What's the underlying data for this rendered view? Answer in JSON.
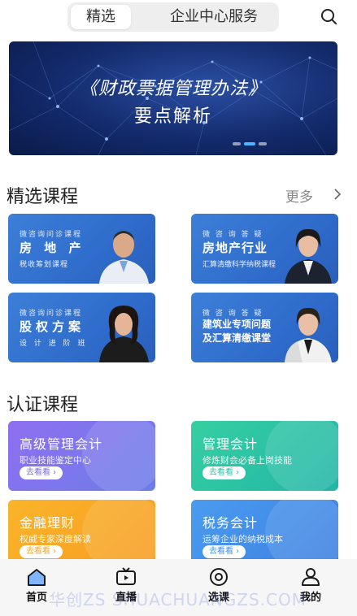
{
  "top_tabs": [
    "精选",
    "企业中心服务"
  ],
  "banner": {
    "line1": "《财政票据管理办法》",
    "line2": "要点解析"
  },
  "featured": {
    "title": "精选课程",
    "more": "更多",
    "courses": [
      {
        "tag": "微咨询问诊课程",
        "title": "房 地 产",
        "sub": "税收筹划课程"
      },
      {
        "tag": "微 咨 询 答 疑",
        "title": "房地产行业",
        "sub": "汇算清缴科学纳税课程"
      },
      {
        "tag": "微咨询问诊课程",
        "title": "股权方案",
        "sub": "设 计 进 阶 班"
      },
      {
        "tag": "微 咨 询 答 疑",
        "title": "建筑业专项问题",
        "title2": "及汇算清缴课堂"
      }
    ]
  },
  "certification": {
    "title": "认证课程",
    "courses": [
      {
        "title": "高级管理会计",
        "sub": "职业技能鉴定中心",
        "btn": "去看看 ›",
        "color": "#7b6fe6"
      },
      {
        "title": "管理会计",
        "sub": "修炼财会必备上岗技能",
        "btn": "去看看 ›",
        "color": "#2fc3a4"
      },
      {
        "title": "金融理财",
        "sub": "权威专家深度解读",
        "btn": "去看看 ›",
        "color": "#f6a623"
      },
      {
        "title": "税务会计",
        "sub": "运筹企业的纳税成本",
        "btn": "去看看 ›",
        "color": "#3d8fe6"
      }
    ]
  },
  "bottom_nav": [
    {
      "label": "首页",
      "icon": "home-icon"
    },
    {
      "label": "直播",
      "icon": "tv-icon"
    },
    {
      "label": "选课",
      "icon": "eye-icon"
    },
    {
      "label": "我的",
      "icon": "person-icon"
    }
  ],
  "watermark": "华创ZS SHUACHUANGZS.COM"
}
